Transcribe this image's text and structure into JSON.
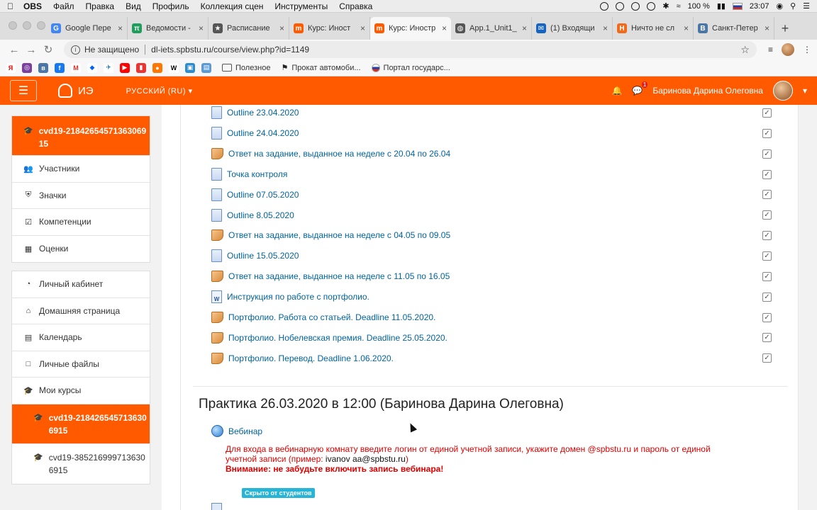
{
  "menubar": {
    "app": "OBS",
    "items": [
      "Файл",
      "Правка",
      "Вид",
      "Профиль",
      "Коллекция сцен",
      "Инструменты",
      "Справка"
    ],
    "battery": "100 %",
    "time": "23:07"
  },
  "tabs": [
    {
      "label": "Google Пере",
      "color": "#4285f4",
      "glyph": "G"
    },
    {
      "label": "Ведомости -",
      "color": "#1e9e5a",
      "glyph": "π"
    },
    {
      "label": "Расписание",
      "color": "#555555",
      "glyph": "★"
    },
    {
      "label": "Курс: Иност",
      "color": "#ff5a00",
      "glyph": "m"
    },
    {
      "label": "Курс: Иностр",
      "color": "#ff5a00",
      "glyph": "m",
      "active": true
    },
    {
      "label": "App.1_Unit1_",
      "color": "#555555",
      "glyph": "◍"
    },
    {
      "label": "(1) Входящи",
      "color": "#1565c0",
      "glyph": "✉"
    },
    {
      "label": "Ничто не сл",
      "color": "#f06a1a",
      "glyph": "H"
    },
    {
      "label": "Санкт-Петер",
      "color": "#4a76a8",
      "glyph": "B"
    }
  ],
  "address": {
    "security": "Не защищено",
    "url": "dl-iets.spbstu.ru/course/view.php?id=1149"
  },
  "bookmarks": {
    "folder": "Полезное",
    "item1": "Прокат автомоби...",
    "item2": "Портал государс..."
  },
  "navbar": {
    "logo_text": "ИЭ",
    "language": "РУССКИЙ (RU)",
    "message_count": "1",
    "user_name": "Баринова Дарина Олеговна"
  },
  "drawer": {
    "course": "cvd19-2184265457136306915",
    "items": [
      "Участники",
      "Значки",
      "Компетенции",
      "Оценки"
    ],
    "nav": [
      "Личный кабинет",
      "Домашняя страница",
      "Календарь",
      "Личные файлы",
      "Мои курсы"
    ],
    "my_courses": [
      "cvd19-2184265457136306915",
      "cvd19-3852169997136306915"
    ]
  },
  "activities": [
    {
      "label": "Outline 23.04.2020",
      "type": "doc"
    },
    {
      "label": "Outline 24.04.2020",
      "type": "doc"
    },
    {
      "label": "Ответ на задание, выданное на неделе с 20.04 по 26.04",
      "type": "assign"
    },
    {
      "label": "Точка контроля",
      "type": "doc"
    },
    {
      "label": "Outline 07.05.2020",
      "type": "doc"
    },
    {
      "label": "Outline 8.05.2020",
      "type": "doc"
    },
    {
      "label": "Ответ на задание, выданное на неделе с 04.05 по 09.05",
      "type": "assign"
    },
    {
      "label": "Outline 15.05.2020",
      "type": "doc"
    },
    {
      "label": "Ответ на задание, выданное на неделе с 11.05 по 16.05",
      "type": "assign"
    },
    {
      "label": "Инструкция по работе с портфолио.",
      "type": "word"
    },
    {
      "label": "Портфолио. Работа со статьей. Deadline 11.05.2020.",
      "type": "assign"
    },
    {
      "label": "Портфолио. Нобелевская премия. Deadline 25.05.2020.",
      "type": "assign"
    },
    {
      "label": "Портфолио. Перевод. Deadline 1.06.2020.",
      "type": "assign"
    }
  ],
  "section": {
    "title": "Практика 26.03.2020 в 12:00 (Баринова Дарина Олеговна)",
    "webinar": "Вебинар",
    "note_part1": "Для входа в вебинарную комнату введите логин от единой учетной записи, укажите домен @spbstu.ru и пароль от единой учетной записи (пример: ",
    "note_example": "ivanov  aa@spbstu.ru",
    "note_part2": ")",
    "note_warning": "Внимание: не забудьте включить запись вебинара!",
    "hidden_badge": "Скрыто от студентов"
  }
}
